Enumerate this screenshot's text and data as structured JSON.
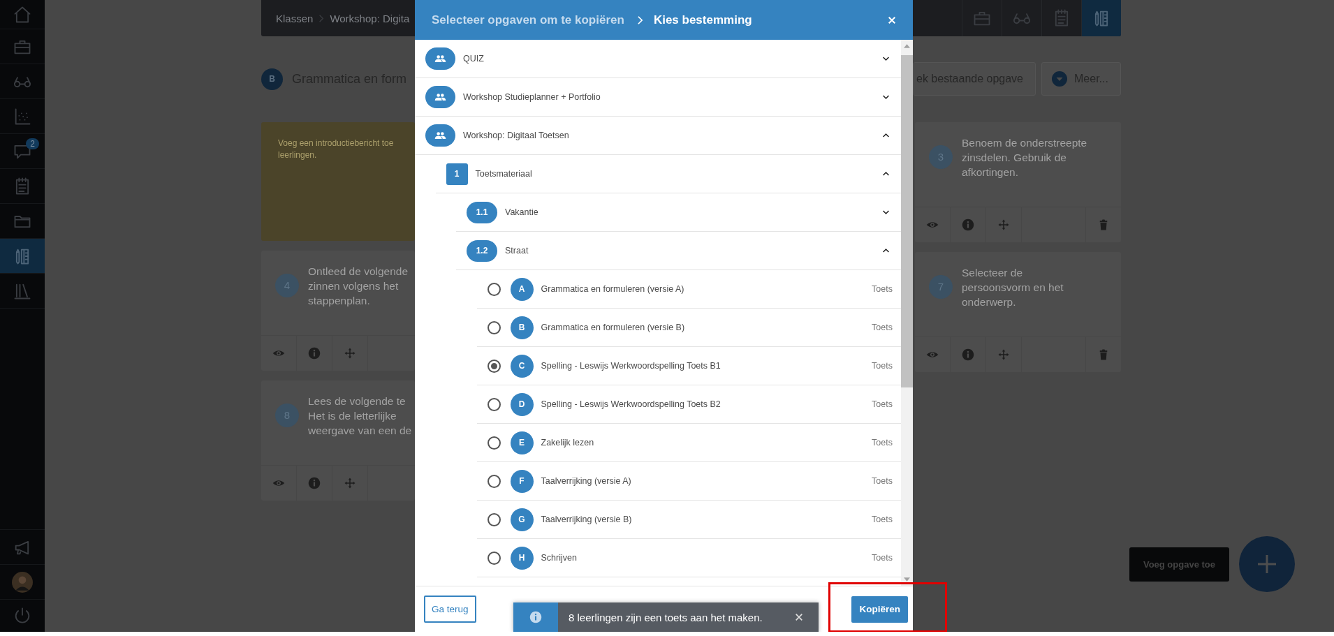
{
  "sidebar": {
    "items": [
      {
        "selected": false
      },
      {
        "selected": false
      },
      {
        "selected": false
      },
      {
        "selected": false
      },
      {
        "selected": false,
        "badge": "2"
      },
      {
        "selected": false
      },
      {
        "selected": false
      },
      {
        "selected": true
      },
      {
        "selected": false
      }
    ]
  },
  "header": {
    "breadcrumb": [
      "Klassen",
      "Workshop: Digita"
    ],
    "tools": [
      {
        "selected": false
      },
      {
        "selected": false
      },
      {
        "selected": false
      },
      {
        "selected": true
      }
    ]
  },
  "page": {
    "badge": "B",
    "title": "Grammatica en form",
    "search_button": "ek bestaande opgave",
    "more_button": "Meer..."
  },
  "intro_card": {
    "lines": [
      "Voeg een introductiebericht toe",
      "leerlingen."
    ]
  },
  "left_cards": [
    {
      "number": "4",
      "lines": [
        "Ontleed de volgende",
        "zinnen volgens het",
        "stappenplan."
      ]
    },
    {
      "number": "8",
      "lines": [
        "Lees de volgende te",
        "Het is de letterlijke",
        "weergave van een de"
      ]
    }
  ],
  "right_cards": [
    {
      "number": "3",
      "lines": [
        "Benoem de onderstreepte",
        "zinsdelen. Gebruik de",
        "afkortingen."
      ]
    },
    {
      "number": "7",
      "lines": [
        "Selecteer de",
        "persoonsvorm en het",
        "onderwerp."
      ]
    }
  ],
  "tooltip": "Voeg opgave toe",
  "dialog": {
    "breadcrumb": "Selecteer opgaven om te kopiëren",
    "title": "Kies bestemming",
    "tree": [
      {
        "label": "QUIZ",
        "expanded": false
      },
      {
        "label": "Workshop Studieplanner + Portfolio",
        "expanded": false
      },
      {
        "label": "Workshop: Digitaal Toetsen",
        "expanded": true,
        "children": [
          {
            "number": "1",
            "label": "Toetsmateriaal",
            "expanded": true,
            "children": [
              {
                "number": "1.1",
                "label": "Vakantie",
                "expanded": false
              },
              {
                "number": "1.2",
                "label": "Straat",
                "expanded": true,
                "children": [
                  {
                    "letter": "A",
                    "title": "Grammatica en formuleren (versie A)",
                    "type": "Toets",
                    "selected": false
                  },
                  {
                    "letter": "B",
                    "title": "Grammatica en formuleren (versie B)",
                    "type": "Toets",
                    "selected": false
                  },
                  {
                    "letter": "C",
                    "title": "Spelling - Leswijs Werkwoordspelling Toets B1",
                    "type": "Toets",
                    "selected": true
                  },
                  {
                    "letter": "D",
                    "title": "Spelling - Leswijs Werkwoordspelling Toets B2",
                    "type": "Toets",
                    "selected": false
                  },
                  {
                    "letter": "E",
                    "title": "Zakelijk lezen",
                    "type": "Toets",
                    "selected": false
                  },
                  {
                    "letter": "F",
                    "title": "Taalverrijking (versie A)",
                    "type": "Toets",
                    "selected": false
                  },
                  {
                    "letter": "G",
                    "title": "Taalverrijking (versie B)",
                    "type": "Toets",
                    "selected": false
                  },
                  {
                    "letter": "H",
                    "title": "Schrijven",
                    "type": "Toets",
                    "selected": false
                  }
                ]
              }
            ]
          }
        ]
      }
    ],
    "back_button": "Ga terug",
    "copy_button": "Kopiëren"
  },
  "toast": {
    "message": "8 leerlingen zijn een toets aan het maken."
  }
}
